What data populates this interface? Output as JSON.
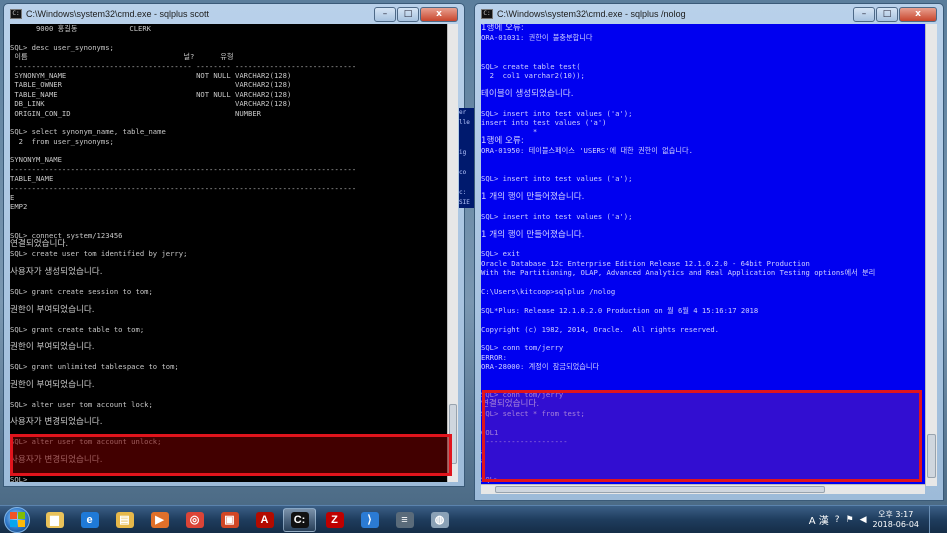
{
  "left_window": {
    "title": "C:\\Windows\\system32\\cmd.exe - sqlplus  scott",
    "lines": [
      "      9000 홍길동            CLERK",
      "",
      "SQL> desc user_synonyms;",
      " 이름                                    널?      유형",
      " ----------------------------------------- -------- ----------------------------",
      " SYNONYM_NAME                              NOT NULL VARCHAR2(128)",
      " TABLE_OWNER                                        VARCHAR2(128)",
      " TABLE_NAME                                NOT NULL VARCHAR2(128)",
      " DB_LINK                                            VARCHAR2(128)",
      " ORIGIN_CON_ID                                      NUMBER",
      "",
      "SQL> select synonym_name, table_name",
      "  2  from user_synonyms;",
      "",
      "SYNONYM_NAME",
      "--------------------------------------------------------------------------------",
      "TABLE_NAME",
      "--------------------------------------------------------------------------------",
      "E",
      "EMP2",
      "",
      "",
      "SQL> connect system/123456",
      "연결되었습니다.",
      "SQL> create user tom identified by jerry;",
      "",
      "사용자가 생성되었습니다.",
      "",
      "SQL> grant create session to tom;",
      "",
      "권한이 부여되었습니다.",
      "",
      "SQL> grant create table to tom;",
      "",
      "권한이 부여되었습니다.",
      "",
      "SQL> grant unlimited tablespace to tom;",
      "",
      "권한이 부여되었습니다.",
      "",
      "SQL> alter user tom account lock;",
      "",
      "사용자가 변경되었습니다.",
      "",
      "SQL> alter user tom account unlock;",
      "",
      "사용자가 변경되었습니다.",
      "",
      "SQL>"
    ]
  },
  "right_window": {
    "title": "C:\\Windows\\system32\\cmd.exe - sqlplus  /nolog",
    "lines": [
      "1행에 오류:",
      "ORA-01031: 권한이 불충분합니다",
      "",
      "",
      "SQL> create table test(",
      "  2  col1 varchar2(10));",
      "",
      "테이블이 생성되었습니다.",
      "",
      "SQL> insert into test values ('a');",
      "insert into test values ('a')",
      "            *",
      "1행에 오류:",
      "ORA-01950: 테이블스페이스 'USERS'에 대한 권한이 없습니다.",
      "",
      "",
      "SQL> insert into test values ('a');",
      "",
      "1 개의 행이 만들어졌습니다.",
      "",
      "SQL> insert into test values ('a');",
      "",
      "1 개의 행이 만들어졌습니다.",
      "",
      "SQL> exit",
      "Oracle Database 12c Enterprise Edition Release 12.1.0.2.0 - 64bit Production",
      "With the Partitioning, OLAP, Advanced Analytics and Real Application Testing options에서 분리",
      "",
      "C:\\Users\\kitcoop>sqlplus /nolog",
      "",
      "SQL*Plus: Release 12.1.0.2.0 Production on 월 6월 4 15:16:17 2018",
      "",
      "Copyright (c) 1982, 2014, Oracle.  All rights reserved.",
      "",
      "SQL> conn tom/jerry",
      "ERROR:",
      "ORA-28000: 계정이 잠금되었습니다",
      "",
      "",
      "SQL> conn tom/jerry",
      "연결되었습니다.",
      "SQL> select * from test;",
      "",
      "COL1",
      "--------------------",
      "a",
      "a",
      "",
      "SQL>"
    ]
  },
  "peek_text": "er\nlle\n\n\nig\n\nco\n\nc:\nSIE\n관원\n",
  "window_buttons": {
    "min": "–",
    "max": "□",
    "close": "x"
  },
  "taskbar": {
    "apps": [
      {
        "name": "start",
        "color": "#2c74c6"
      },
      {
        "name": "explorer-icon",
        "color": "#e9c25a",
        "glyph": "▆"
      },
      {
        "name": "ie-icon",
        "color": "#1f7ad8",
        "glyph": "e"
      },
      {
        "name": "folder-icon",
        "color": "#e6b84a",
        "glyph": "▤"
      },
      {
        "name": "media-icon",
        "color": "#e0702a",
        "glyph": "▶"
      },
      {
        "name": "chrome-icon",
        "color": "#db4437",
        "glyph": "◎"
      },
      {
        "name": "office-icon",
        "color": "#d24726",
        "glyph": "▣"
      },
      {
        "name": "acrobat-icon",
        "color": "#b30b00",
        "glyph": "A"
      },
      {
        "name": "cmd-icon",
        "color": "#111111",
        "glyph": "C:"
      },
      {
        "name": "filezilla-icon",
        "color": "#bf0000",
        "glyph": "Z"
      },
      {
        "name": "vscode-icon",
        "color": "#2b7bd4",
        "glyph": "⟩"
      },
      {
        "name": "db-icon",
        "color": "#5a6b7a",
        "glyph": "≡"
      },
      {
        "name": "magnifier-icon",
        "color": "#8aa1b6",
        "glyph": "◍"
      }
    ],
    "tray_ime": "A 漢",
    "clock_time": "오후 3:17",
    "clock_date": "2018-06-04"
  }
}
